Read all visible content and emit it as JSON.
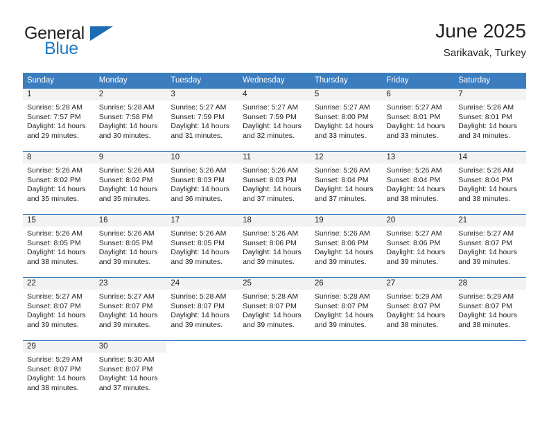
{
  "brand": {
    "name_part1": "General",
    "name_part2": "Blue",
    "flag_icon": "triangle-flag-icon"
  },
  "header": {
    "title": "June 2025",
    "location": "Sarikavak, Turkey"
  },
  "colors": {
    "header_blue": "#3b7dbf",
    "brand_blue": "#1b79c4",
    "daynum_band": "#f2f2f2",
    "text": "#222222"
  },
  "calendar": {
    "weekday_headers": [
      "Sunday",
      "Monday",
      "Tuesday",
      "Wednesday",
      "Thursday",
      "Friday",
      "Saturday"
    ],
    "weeks": [
      [
        {
          "day": "1",
          "sunrise": "Sunrise: 5:28 AM",
          "sunset": "Sunset: 7:57 PM",
          "daylight1": "Daylight: 14 hours",
          "daylight2": "and 29 minutes."
        },
        {
          "day": "2",
          "sunrise": "Sunrise: 5:28 AM",
          "sunset": "Sunset: 7:58 PM",
          "daylight1": "Daylight: 14 hours",
          "daylight2": "and 30 minutes."
        },
        {
          "day": "3",
          "sunrise": "Sunrise: 5:27 AM",
          "sunset": "Sunset: 7:59 PM",
          "daylight1": "Daylight: 14 hours",
          "daylight2": "and 31 minutes."
        },
        {
          "day": "4",
          "sunrise": "Sunrise: 5:27 AM",
          "sunset": "Sunset: 7:59 PM",
          "daylight1": "Daylight: 14 hours",
          "daylight2": "and 32 minutes."
        },
        {
          "day": "5",
          "sunrise": "Sunrise: 5:27 AM",
          "sunset": "Sunset: 8:00 PM",
          "daylight1": "Daylight: 14 hours",
          "daylight2": "and 33 minutes."
        },
        {
          "day": "6",
          "sunrise": "Sunrise: 5:27 AM",
          "sunset": "Sunset: 8:01 PM",
          "daylight1": "Daylight: 14 hours",
          "daylight2": "and 33 minutes."
        },
        {
          "day": "7",
          "sunrise": "Sunrise: 5:26 AM",
          "sunset": "Sunset: 8:01 PM",
          "daylight1": "Daylight: 14 hours",
          "daylight2": "and 34 minutes."
        }
      ],
      [
        {
          "day": "8",
          "sunrise": "Sunrise: 5:26 AM",
          "sunset": "Sunset: 8:02 PM",
          "daylight1": "Daylight: 14 hours",
          "daylight2": "and 35 minutes."
        },
        {
          "day": "9",
          "sunrise": "Sunrise: 5:26 AM",
          "sunset": "Sunset: 8:02 PM",
          "daylight1": "Daylight: 14 hours",
          "daylight2": "and 35 minutes."
        },
        {
          "day": "10",
          "sunrise": "Sunrise: 5:26 AM",
          "sunset": "Sunset: 8:03 PM",
          "daylight1": "Daylight: 14 hours",
          "daylight2": "and 36 minutes."
        },
        {
          "day": "11",
          "sunrise": "Sunrise: 5:26 AM",
          "sunset": "Sunset: 8:03 PM",
          "daylight1": "Daylight: 14 hours",
          "daylight2": "and 37 minutes."
        },
        {
          "day": "12",
          "sunrise": "Sunrise: 5:26 AM",
          "sunset": "Sunset: 8:04 PM",
          "daylight1": "Daylight: 14 hours",
          "daylight2": "and 37 minutes."
        },
        {
          "day": "13",
          "sunrise": "Sunrise: 5:26 AM",
          "sunset": "Sunset: 8:04 PM",
          "daylight1": "Daylight: 14 hours",
          "daylight2": "and 38 minutes."
        },
        {
          "day": "14",
          "sunrise": "Sunrise: 5:26 AM",
          "sunset": "Sunset: 8:04 PM",
          "daylight1": "Daylight: 14 hours",
          "daylight2": "and 38 minutes."
        }
      ],
      [
        {
          "day": "15",
          "sunrise": "Sunrise: 5:26 AM",
          "sunset": "Sunset: 8:05 PM",
          "daylight1": "Daylight: 14 hours",
          "daylight2": "and 38 minutes."
        },
        {
          "day": "16",
          "sunrise": "Sunrise: 5:26 AM",
          "sunset": "Sunset: 8:05 PM",
          "daylight1": "Daylight: 14 hours",
          "daylight2": "and 39 minutes."
        },
        {
          "day": "17",
          "sunrise": "Sunrise: 5:26 AM",
          "sunset": "Sunset: 8:05 PM",
          "daylight1": "Daylight: 14 hours",
          "daylight2": "and 39 minutes."
        },
        {
          "day": "18",
          "sunrise": "Sunrise: 5:26 AM",
          "sunset": "Sunset: 8:06 PM",
          "daylight1": "Daylight: 14 hours",
          "daylight2": "and 39 minutes."
        },
        {
          "day": "19",
          "sunrise": "Sunrise: 5:26 AM",
          "sunset": "Sunset: 8:06 PM",
          "daylight1": "Daylight: 14 hours",
          "daylight2": "and 39 minutes."
        },
        {
          "day": "20",
          "sunrise": "Sunrise: 5:27 AM",
          "sunset": "Sunset: 8:06 PM",
          "daylight1": "Daylight: 14 hours",
          "daylight2": "and 39 minutes."
        },
        {
          "day": "21",
          "sunrise": "Sunrise: 5:27 AM",
          "sunset": "Sunset: 8:07 PM",
          "daylight1": "Daylight: 14 hours",
          "daylight2": "and 39 minutes."
        }
      ],
      [
        {
          "day": "22",
          "sunrise": "Sunrise: 5:27 AM",
          "sunset": "Sunset: 8:07 PM",
          "daylight1": "Daylight: 14 hours",
          "daylight2": "and 39 minutes."
        },
        {
          "day": "23",
          "sunrise": "Sunrise: 5:27 AM",
          "sunset": "Sunset: 8:07 PM",
          "daylight1": "Daylight: 14 hours",
          "daylight2": "and 39 minutes."
        },
        {
          "day": "24",
          "sunrise": "Sunrise: 5:28 AM",
          "sunset": "Sunset: 8:07 PM",
          "daylight1": "Daylight: 14 hours",
          "daylight2": "and 39 minutes."
        },
        {
          "day": "25",
          "sunrise": "Sunrise: 5:28 AM",
          "sunset": "Sunset: 8:07 PM",
          "daylight1": "Daylight: 14 hours",
          "daylight2": "and 39 minutes."
        },
        {
          "day": "26",
          "sunrise": "Sunrise: 5:28 AM",
          "sunset": "Sunset: 8:07 PM",
          "daylight1": "Daylight: 14 hours",
          "daylight2": "and 39 minutes."
        },
        {
          "day": "27",
          "sunrise": "Sunrise: 5:29 AM",
          "sunset": "Sunset: 8:07 PM",
          "daylight1": "Daylight: 14 hours",
          "daylight2": "and 38 minutes."
        },
        {
          "day": "28",
          "sunrise": "Sunrise: 5:29 AM",
          "sunset": "Sunset: 8:07 PM",
          "daylight1": "Daylight: 14 hours",
          "daylight2": "and 38 minutes."
        }
      ],
      [
        {
          "day": "29",
          "sunrise": "Sunrise: 5:29 AM",
          "sunset": "Sunset: 8:07 PM",
          "daylight1": "Daylight: 14 hours",
          "daylight2": "and 38 minutes."
        },
        {
          "day": "30",
          "sunrise": "Sunrise: 5:30 AM",
          "sunset": "Sunset: 8:07 PM",
          "daylight1": "Daylight: 14 hours",
          "daylight2": "and 37 minutes."
        },
        {
          "day": "",
          "sunrise": "",
          "sunset": "",
          "daylight1": "",
          "daylight2": ""
        },
        {
          "day": "",
          "sunrise": "",
          "sunset": "",
          "daylight1": "",
          "daylight2": ""
        },
        {
          "day": "",
          "sunrise": "",
          "sunset": "",
          "daylight1": "",
          "daylight2": ""
        },
        {
          "day": "",
          "sunrise": "",
          "sunset": "",
          "daylight1": "",
          "daylight2": ""
        },
        {
          "day": "",
          "sunrise": "",
          "sunset": "",
          "daylight1": "",
          "daylight2": ""
        }
      ]
    ]
  }
}
